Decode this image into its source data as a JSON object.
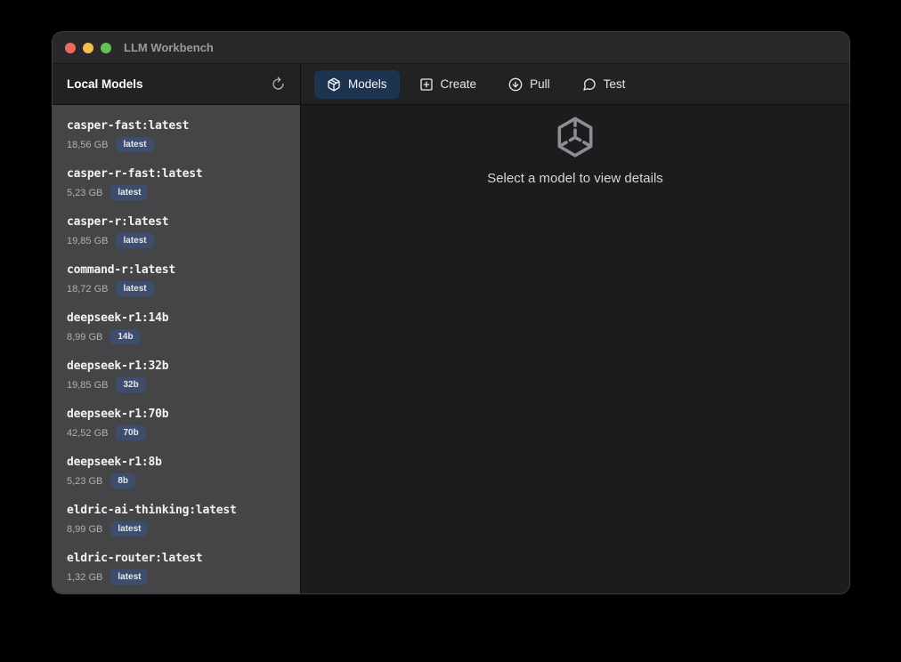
{
  "window": {
    "title": "LLM Workbench"
  },
  "titlebar": {
    "traffic_lights": [
      "close",
      "minimize",
      "zoom"
    ],
    "colors": {
      "red": "#ec6a5e",
      "yellow": "#f5bf4f",
      "green": "#61c455"
    }
  },
  "sidebar": {
    "header": "Local Models",
    "refresh_icon": "refresh-icon",
    "models": [
      {
        "name": "casper-fast:latest",
        "size": "18,56 GB",
        "tag": "latest"
      },
      {
        "name": "casper-r-fast:latest",
        "size": "5,23 GB",
        "tag": "latest"
      },
      {
        "name": "casper-r:latest",
        "size": "19,85 GB",
        "tag": "latest"
      },
      {
        "name": "command-r:latest",
        "size": "18,72 GB",
        "tag": "latest"
      },
      {
        "name": "deepseek-r1:14b",
        "size": "8,99 GB",
        "tag": "14b"
      },
      {
        "name": "deepseek-r1:32b",
        "size": "19,85 GB",
        "tag": "32b"
      },
      {
        "name": "deepseek-r1:70b",
        "size": "42,52 GB",
        "tag": "70b"
      },
      {
        "name": "deepseek-r1:8b",
        "size": "5,23 GB",
        "tag": "8b"
      },
      {
        "name": "eldric-ai-thinking:latest",
        "size": "8,99 GB",
        "tag": "latest"
      },
      {
        "name": "eldric-router:latest",
        "size": "1,32 GB",
        "tag": "latest"
      }
    ]
  },
  "tabs": [
    {
      "label": "Models",
      "icon": "package-icon",
      "active": true
    },
    {
      "label": "Create",
      "icon": "plus-square-icon",
      "active": false
    },
    {
      "label": "Pull",
      "icon": "download-circle-icon",
      "active": false
    },
    {
      "label": "Test",
      "icon": "chat-bubble-icon",
      "active": false
    }
  ],
  "main": {
    "empty_state": {
      "icon": "cube-wireframe-icon",
      "message": "Select a model to view details"
    }
  },
  "colors": {
    "active_tab_bg": "#1c3450",
    "badge_bg": "#3e4d6b",
    "sidebar_bg": "#454547",
    "main_bg": "#1c1c1e",
    "titlebar_bg": "#29292b"
  }
}
